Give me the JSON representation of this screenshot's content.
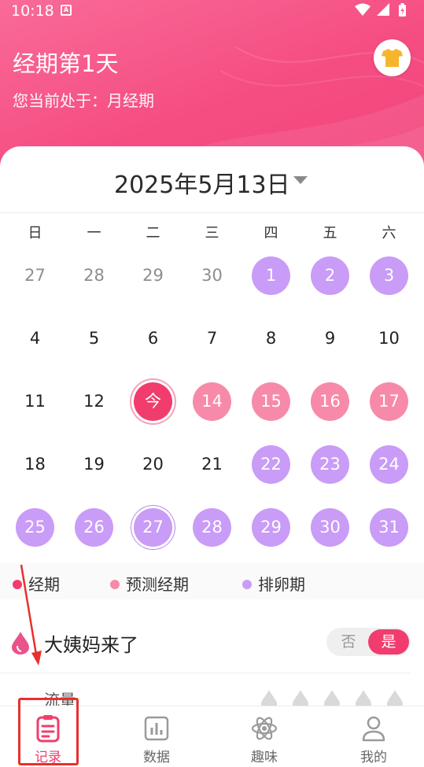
{
  "status_bar": {
    "time": "10:18",
    "app_badge": "A"
  },
  "header": {
    "title": "经期第1天",
    "subtitle": "您当前处于：月经期",
    "skin_button_icon": "tshirt-icon"
  },
  "calendar": {
    "current_date": "2025年5月13日",
    "weekdays": [
      "日",
      "一",
      "二",
      "三",
      "四",
      "五",
      "六"
    ],
    "rows": [
      [
        {
          "label": "27",
          "type": "dim"
        },
        {
          "label": "28",
          "type": "dim"
        },
        {
          "label": "29",
          "type": "dim"
        },
        {
          "label": "30",
          "type": "dim"
        },
        {
          "label": "1",
          "type": "ovu"
        },
        {
          "label": "2",
          "type": "ovu"
        },
        {
          "label": "3",
          "type": "ovu"
        }
      ],
      [
        {
          "label": "4",
          "type": "normal"
        },
        {
          "label": "5",
          "type": "normal"
        },
        {
          "label": "6",
          "type": "normal"
        },
        {
          "label": "7",
          "type": "normal"
        },
        {
          "label": "8",
          "type": "normal"
        },
        {
          "label": "9",
          "type": "normal"
        },
        {
          "label": "10",
          "type": "normal"
        }
      ],
      [
        {
          "label": "11",
          "type": "normal"
        },
        {
          "label": "12",
          "type": "normal"
        },
        {
          "label": "今",
          "type": "today"
        },
        {
          "label": "14",
          "type": "pred"
        },
        {
          "label": "15",
          "type": "pred"
        },
        {
          "label": "16",
          "type": "pred"
        },
        {
          "label": "17",
          "type": "pred"
        }
      ],
      [
        {
          "label": "18",
          "type": "normal"
        },
        {
          "label": "19",
          "type": "normal"
        },
        {
          "label": "20",
          "type": "normal"
        },
        {
          "label": "21",
          "type": "normal"
        },
        {
          "label": "22",
          "type": "ovu"
        },
        {
          "label": "23",
          "type": "ovu"
        },
        {
          "label": "24",
          "type": "ovu"
        }
      ],
      [
        {
          "label": "25",
          "type": "ovu"
        },
        {
          "label": "26",
          "type": "ovu"
        },
        {
          "label": "27",
          "type": "ovu sel"
        },
        {
          "label": "28",
          "type": "ovu"
        },
        {
          "label": "29",
          "type": "ovu"
        },
        {
          "label": "30",
          "type": "ovu"
        },
        {
          "label": "31",
          "type": "ovu"
        }
      ]
    ]
  },
  "legend": [
    {
      "label": "经期",
      "color": "#f03d6e"
    },
    {
      "label": "预测经期",
      "color": "#f78aa8"
    },
    {
      "label": "排卵期",
      "color": "#c99cf7"
    }
  ],
  "period_toggle": {
    "label": "大姨妈来了",
    "no_label": "否",
    "yes_label": "是",
    "selected": "是"
  },
  "flow": {
    "label": "流量",
    "level_icons": 5
  },
  "tabs": [
    {
      "label": "记录",
      "icon": "record-icon",
      "active": true
    },
    {
      "label": "数据",
      "icon": "chart-icon",
      "active": false
    },
    {
      "label": "趣味",
      "icon": "atom-icon",
      "active": false
    },
    {
      "label": "我的",
      "icon": "profile-icon",
      "active": false
    }
  ],
  "colors": {
    "brand": "#f03d6e",
    "ovulation": "#c99cf7",
    "predicted": "#f78aa8",
    "annotation": "#e8312e"
  }
}
